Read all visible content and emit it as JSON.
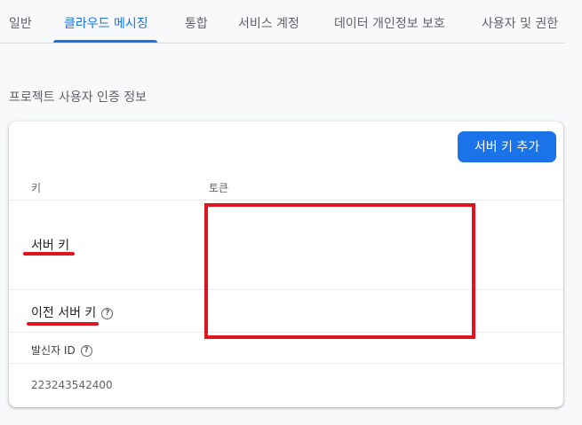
{
  "tabs": [
    {
      "label": "일반",
      "active": false
    },
    {
      "label": "클라우드 메시징",
      "active": true
    },
    {
      "label": "통합",
      "active": false
    },
    {
      "label": "서비스 계정",
      "active": false
    },
    {
      "label": "데이터 개인정보 보호",
      "active": false
    },
    {
      "label": "사용자 및 권한",
      "active": false
    }
  ],
  "section": {
    "title": "프로젝트 사용자 인증 정보"
  },
  "card": {
    "add_button_label": "서버 키 추가",
    "columns": {
      "key": "키",
      "token": "토큰"
    },
    "rows": [
      {
        "key": "서버 키",
        "token": ""
      },
      {
        "key": "이전 서버 키",
        "token": ""
      }
    ],
    "sender": {
      "label": "발신자 ID",
      "value": "223243542400"
    }
  },
  "icons": {
    "help": "help-circle-icon"
  },
  "colors": {
    "accent": "#1a73e8",
    "annotation": "#e0141e"
  }
}
